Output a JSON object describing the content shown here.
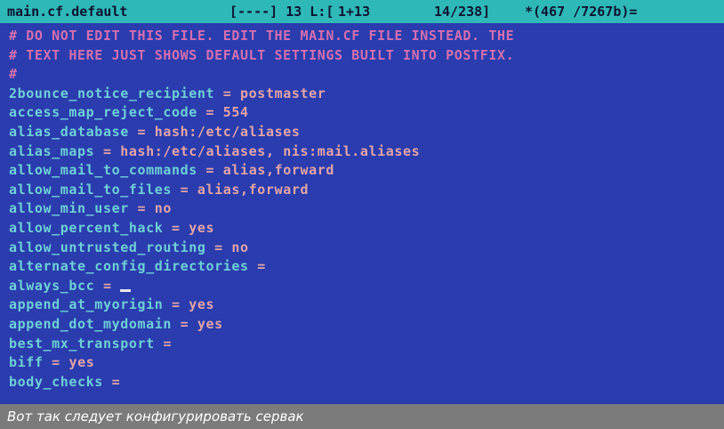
{
  "status": {
    "filename": "main.cf.default",
    "mode": "[----] 13 L:[",
    "position": "1+13",
    "lines": "14/238]",
    "bytes": "*(467 /7267b)="
  },
  "lines": [
    {
      "kind": "comment",
      "text": "# DO NOT EDIT THIS FILE. EDIT THE MAIN.CF FILE INSTEAD. THE"
    },
    {
      "kind": "comment",
      "text": "# TEXT HERE JUST SHOWS DEFAULT SETTINGS BUILT INTO POSTFIX."
    },
    {
      "kind": "comment",
      "text": "#"
    },
    {
      "kind": "setting",
      "key": "2bounce_notice_recipient",
      "value": "postmaster"
    },
    {
      "kind": "setting",
      "key": "access_map_reject_code",
      "value": "554"
    },
    {
      "kind": "setting",
      "key": "alias_database",
      "value": "hash:/etc/aliases"
    },
    {
      "kind": "setting",
      "key": "alias_maps",
      "value": "hash:/etc/aliases, nis:mail.aliases"
    },
    {
      "kind": "setting",
      "key": "allow_mail_to_commands",
      "value": "alias,forward"
    },
    {
      "kind": "setting",
      "key": "allow_mail_to_files",
      "value": "alias,forward"
    },
    {
      "kind": "setting",
      "key": "allow_min_user",
      "value": "no"
    },
    {
      "kind": "setting",
      "key": "allow_percent_hack",
      "value": "yes"
    },
    {
      "kind": "setting",
      "key": "allow_untrusted_routing",
      "value": "no"
    },
    {
      "kind": "setting",
      "key": "alternate_config_directories",
      "value": ""
    },
    {
      "kind": "setting",
      "key": "always_bcc",
      "value": "",
      "cursor": true
    },
    {
      "kind": "setting",
      "key": "append_at_myorigin",
      "value": "yes"
    },
    {
      "kind": "setting",
      "key": "append_dot_mydomain",
      "value": "yes"
    },
    {
      "kind": "setting",
      "key": "best_mx_transport",
      "value": ""
    },
    {
      "kind": "setting",
      "key": "biff",
      "value": "yes"
    },
    {
      "kind": "setting",
      "key": "body_checks",
      "value": ""
    }
  ],
  "caption": "Вот так следует конфигурировать сервак",
  "colors": {
    "background": "#2a3cae",
    "status_bar": "#2fb8b8",
    "comment": "#d46fb0",
    "key": "#6fd0d8",
    "value": "#e3a4a8",
    "caption_bg": "#7b7b7b"
  }
}
